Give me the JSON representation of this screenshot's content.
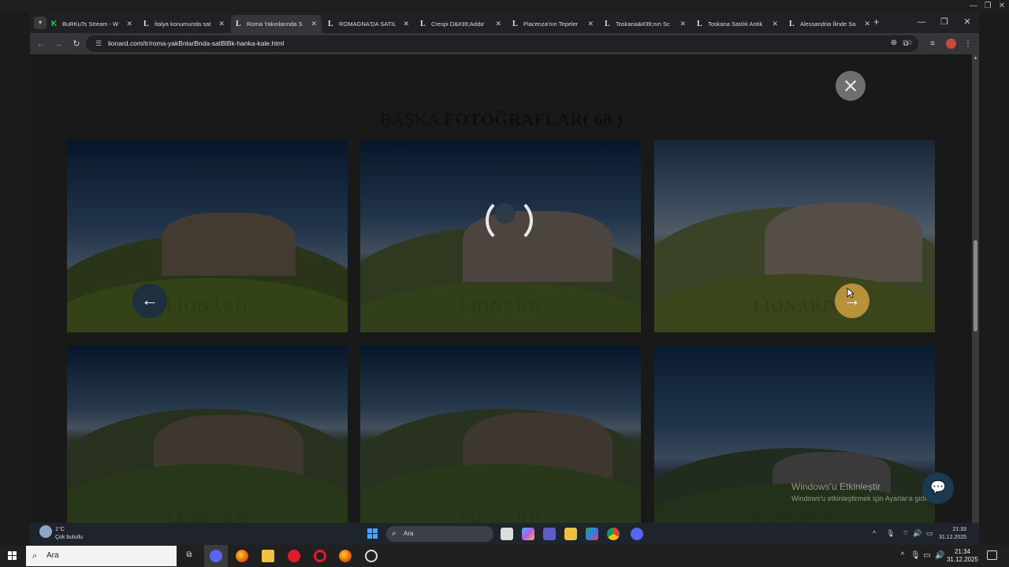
{
  "host": {
    "controls": [
      "—",
      "❐",
      "✕"
    ]
  },
  "browser": {
    "tabs": [
      {
        "favicon": "K",
        "title": "BuRKuTs Stream - W",
        "active": false
      },
      {
        "favicon": "L",
        "title": "İtalya konumunda sat",
        "active": false
      },
      {
        "favicon": "L",
        "title": "Roma Yakınlarında S",
        "active": true
      },
      {
        "favicon": "L",
        "title": "ROMAGNA'DA SATIL",
        "active": false
      },
      {
        "favicon": "L",
        "title": "Crespi D&#39;Adda'",
        "active": false
      },
      {
        "favicon": "L",
        "title": "Piacenza'nın Tepeler",
        "active": false
      },
      {
        "favicon": "L",
        "title": "Toskana&#39;nın Sc",
        "active": false
      },
      {
        "favicon": "L",
        "title": "Toskana Satılık Antik",
        "active": false
      },
      {
        "favicon": "L",
        "title": "Alessandria İlinde Sa",
        "active": false
      }
    ],
    "tab_close_glyph": "✕",
    "new_tab_glyph": "+",
    "window_controls": [
      "—",
      "❐",
      "✕"
    ],
    "url": "lionard.com/tr/roma-yakBnlarBnda-satBlBk-hanka-kale.html"
  },
  "page": {
    "gallery_title_prefix": "BAŞKA",
    "gallery_title_bold": "FOTOĞRAFLAR",
    "gallery_count": "( 68 )",
    "watermark": "LIONARD",
    "prev_arrow": "←",
    "next_arrow": "→",
    "activation_title": "Windows'u Etkinleştir",
    "activation_subtitle": "Windows'u etkinleştirmek için Ayarlar'a gidin."
  },
  "inner_taskbar": {
    "temperature": "1°C",
    "weather": "Çok bulutlu",
    "search_label": "Ara",
    "time": "21:33",
    "date": "31.12.2025"
  },
  "outer_taskbar": {
    "search_label": "Ara",
    "time": "21:34",
    "date": "31.12.2025"
  },
  "colors": {
    "accent_gold": "#b8923a",
    "active_tab": "#35363a"
  }
}
